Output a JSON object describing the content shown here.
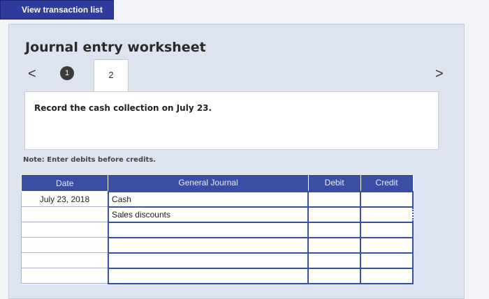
{
  "top_button": {
    "label": "View transaction list"
  },
  "worksheet": {
    "title": "Journal entry worksheet",
    "prev_glyph": "<",
    "next_glyph": ">",
    "step1": "1",
    "step2": "2",
    "prompt": "Record the cash collection on July 23.",
    "note": "Note: Enter debits before credits."
  },
  "table": {
    "headers": {
      "date": "Date",
      "journal": "General Journal",
      "debit": "Debit",
      "credit": "Credit"
    },
    "rows": [
      {
        "date": "July 23, 2018",
        "account": "Cash",
        "debit": "",
        "credit": ""
      },
      {
        "date": "",
        "account": "Sales discounts",
        "debit": "",
        "credit": ""
      },
      {
        "date": "",
        "account": "",
        "debit": "",
        "credit": ""
      },
      {
        "date": "",
        "account": "",
        "debit": "",
        "credit": ""
      },
      {
        "date": "",
        "account": "",
        "debit": "",
        "credit": ""
      },
      {
        "date": "",
        "account": "",
        "debit": "",
        "credit": ""
      }
    ]
  },
  "colors": {
    "header": "#3a4fa3",
    "button": "#2f3c9e",
    "panel": "#dde4ef"
  }
}
